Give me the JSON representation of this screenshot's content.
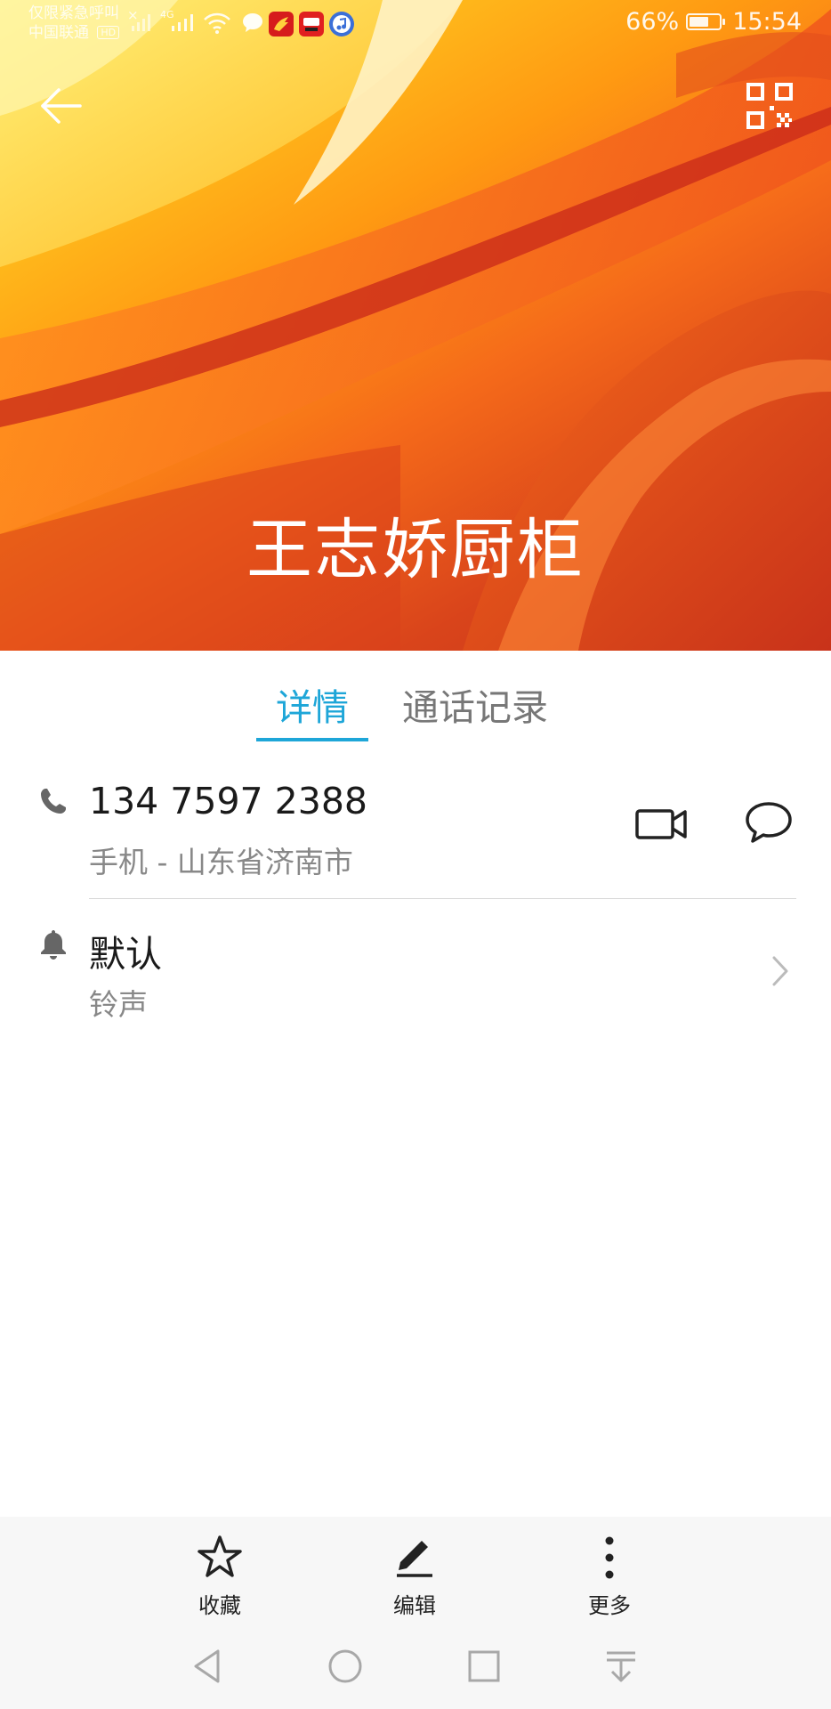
{
  "status_bar": {
    "emergency_text": "仅限紧急呼叫",
    "carrier": "中国联通",
    "hd_badge": "HD",
    "network": "4G",
    "battery_percent": "66%",
    "battery_level": 0.66,
    "time": "15:54"
  },
  "header": {
    "back_icon": "arrow-left-icon",
    "qr_icon": "qr-code-icon",
    "contact_name": "王志娇厨柜"
  },
  "tabs": [
    {
      "label": "详情",
      "active": true
    },
    {
      "label": "通话记录",
      "active": false
    }
  ],
  "phone": {
    "number": "134 7597 2388",
    "type_location": "手机 - 山东省济南市"
  },
  "ringtone": {
    "value": "默认",
    "label": "铃声"
  },
  "actions": {
    "favorite": "收藏",
    "edit": "编辑",
    "more": "更多"
  },
  "colors": {
    "accent": "#1ea6d8",
    "header_gradient": [
      "#ffe35a",
      "#ff9a12",
      "#d9441b"
    ]
  }
}
